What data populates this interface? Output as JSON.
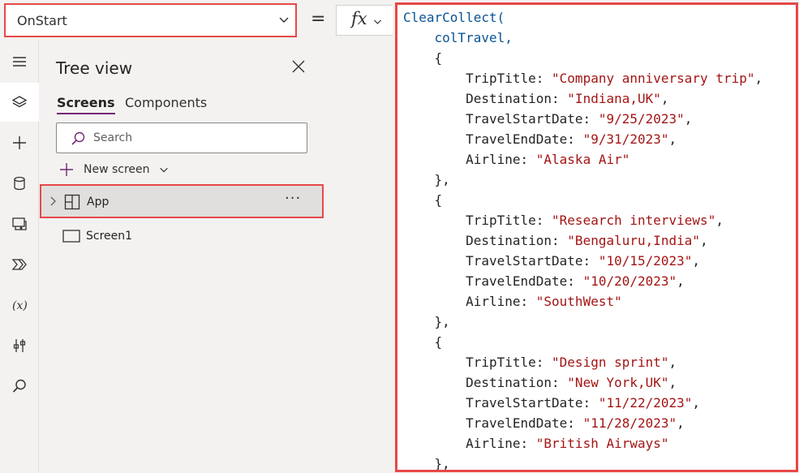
{
  "formula_bar": {
    "property": "OnStart",
    "equals": "=",
    "fx": "fx"
  },
  "tree_view": {
    "title": "Tree view",
    "tabs": [
      {
        "label": "Screens",
        "active": true
      },
      {
        "label": "Components",
        "active": false
      }
    ],
    "search": {
      "placeholder": "Search"
    },
    "new_screen": {
      "label": "New screen"
    },
    "items": [
      {
        "label": "App",
        "more": "···",
        "selected": true
      },
      {
        "label": "Screen1"
      }
    ]
  },
  "colors": {
    "highlight_border": "#e64848",
    "accent": "#742774",
    "string": "#a31515",
    "function": "#0b5394"
  },
  "code": {
    "function": "ClearCollect(",
    "collection": "colTravel,",
    "records": [
      {
        "TripTitle": "\"Company anniversary trip\"",
        "Destination": "\"Indiana,UK\"",
        "TravelStartDate": "\"9/25/2023\"",
        "TravelEndDate": "\"9/31/2023\"",
        "Airline": "\"Alaska Air\""
      },
      {
        "TripTitle": "\"Research interviews\"",
        "Destination": "\"Bengaluru,India\"",
        "TravelStartDate": "\"10/15/2023\"",
        "TravelEndDate": "\"10/20/2023\"",
        "Airline": "\"SouthWest\""
      },
      {
        "TripTitle": "\"Design sprint\"",
        "Destination": "\"New York,UK\"",
        "TravelStartDate": "\"11/22/2023\"",
        "TravelEndDate": "\"11/28/2023\"",
        "Airline": "\"British Airways\""
      }
    ]
  }
}
